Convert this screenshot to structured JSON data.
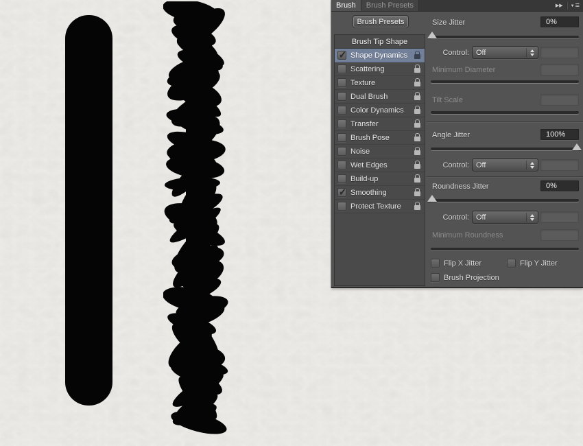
{
  "canvas": {
    "background_color": "#ECEBE6",
    "stroke_color": "#050505",
    "strokes": [
      {
        "name": "smooth-stroke",
        "description": "solid vertical brush stroke without shape dynamics"
      },
      {
        "name": "jitter-stroke",
        "description": "vertical brush stroke with 100% angle jitter"
      }
    ]
  },
  "panel": {
    "tabs": [
      {
        "label": "Brush",
        "active": true
      },
      {
        "label": "Brush Presets",
        "active": false
      }
    ],
    "icons": {
      "collapse": "▶▶",
      "menu_arrow": "▼",
      "menu_lines": "≡"
    },
    "presets_button": "Brush Presets",
    "list": {
      "header": "Brush Tip Shape",
      "items": [
        {
          "label": "Shape Dynamics",
          "checked": true,
          "selected": true
        },
        {
          "label": "Scattering",
          "checked": false,
          "selected": false
        },
        {
          "label": "Texture",
          "checked": false,
          "selected": false
        },
        {
          "label": "Dual Brush",
          "checked": false,
          "selected": false
        },
        {
          "label": "Color Dynamics",
          "checked": false,
          "selected": false
        },
        {
          "label": "Transfer",
          "checked": false,
          "selected": false
        },
        {
          "label": "Brush Pose",
          "checked": false,
          "selected": false
        },
        {
          "label": "Noise",
          "checked": false,
          "selected": false
        },
        {
          "label": "Wet Edges",
          "checked": false,
          "selected": false
        },
        {
          "label": "Build-up",
          "checked": false,
          "selected": false
        },
        {
          "label": "Smoothing",
          "checked": true,
          "selected": false
        },
        {
          "label": "Protect Texture",
          "checked": false,
          "selected": false
        }
      ]
    },
    "controls": {
      "size_jitter": {
        "label": "Size Jitter",
        "value": "0%",
        "slider_percent": 0
      },
      "size_control": {
        "label": "Control:",
        "value": "Off"
      },
      "minimum_diameter": {
        "label": "Minimum Diameter",
        "disabled": true
      },
      "tilt_scale": {
        "label": "Tilt Scale",
        "disabled": true
      },
      "angle_jitter": {
        "label": "Angle Jitter",
        "value": "100%",
        "slider_percent": 100
      },
      "angle_control": {
        "label": "Control:",
        "value": "Off"
      },
      "roundness_jitter": {
        "label": "Roundness Jitter",
        "value": "0%",
        "slider_percent": 0
      },
      "roundness_control": {
        "label": "Control:",
        "value": "Off"
      },
      "minimum_roundness": {
        "label": "Minimum Roundness",
        "disabled": true
      },
      "flip_x_jitter": {
        "label": "Flip X Jitter",
        "checked": false
      },
      "flip_y_jitter": {
        "label": "Flip Y Jitter",
        "checked": false
      },
      "brush_projection": {
        "label": "Brush Projection",
        "checked": false
      }
    },
    "colors": {
      "panel_bg": "#535353",
      "list_bg": "#4A4A4A",
      "selection": "#73809A",
      "value_box_bg": "#2D2D2D"
    }
  }
}
